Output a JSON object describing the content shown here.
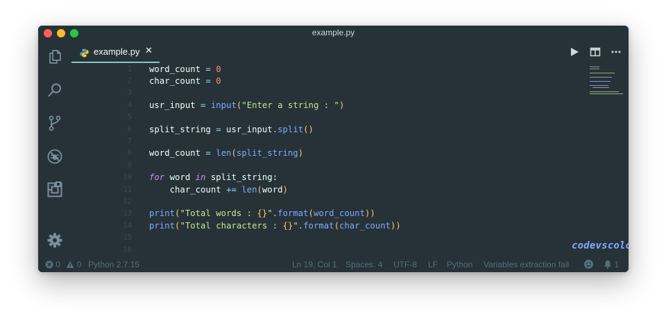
{
  "window": {
    "title": "example.py"
  },
  "tab": {
    "label": "example.py",
    "close": "✕"
  },
  "editor": {
    "lines": [
      {
        "num": "1",
        "tokens": [
          {
            "t": "word_count ",
            "c": "text"
          },
          {
            "t": "=",
            "c": "op"
          },
          {
            "t": " ",
            "c": "text"
          },
          {
            "t": "0",
            "c": "num"
          }
        ]
      },
      {
        "num": "2",
        "tokens": [
          {
            "t": "char_count ",
            "c": "text"
          },
          {
            "t": "=",
            "c": "op"
          },
          {
            "t": " ",
            "c": "text"
          },
          {
            "t": "0",
            "c": "num"
          }
        ]
      },
      {
        "num": "3",
        "tokens": []
      },
      {
        "num": "4",
        "tokens": [
          {
            "t": "usr_input ",
            "c": "text"
          },
          {
            "t": "=",
            "c": "op"
          },
          {
            "t": " ",
            "c": "text"
          },
          {
            "t": "input",
            "c": "func"
          },
          {
            "t": "(",
            "c": "paren"
          },
          {
            "t": "\"Enter a string : \"",
            "c": "str"
          },
          {
            "t": ")",
            "c": "paren"
          }
        ]
      },
      {
        "num": "5",
        "tokens": []
      },
      {
        "num": "6",
        "tokens": [
          {
            "t": "split_string ",
            "c": "text"
          },
          {
            "t": "=",
            "c": "op"
          },
          {
            "t": " usr_input",
            "c": "text"
          },
          {
            "t": ".",
            "c": "op"
          },
          {
            "t": "split",
            "c": "func"
          },
          {
            "t": "()",
            "c": "paren"
          }
        ]
      },
      {
        "num": "7",
        "tokens": []
      },
      {
        "num": "8",
        "tokens": [
          {
            "t": "word_count ",
            "c": "text"
          },
          {
            "t": "=",
            "c": "op"
          },
          {
            "t": " ",
            "c": "text"
          },
          {
            "t": "len",
            "c": "func"
          },
          {
            "t": "(",
            "c": "paren"
          },
          {
            "t": "split_string",
            "c": "func"
          },
          {
            "t": ")",
            "c": "paren"
          }
        ]
      },
      {
        "num": "9",
        "tokens": []
      },
      {
        "num": "10",
        "tokens": [
          {
            "t": "for",
            "c": "kw"
          },
          {
            "t": " word ",
            "c": "text"
          },
          {
            "t": "in",
            "c": "kw"
          },
          {
            "t": " split_string:",
            "c": "text"
          }
        ]
      },
      {
        "num": "11",
        "tokens": [
          {
            "t": "    char_count ",
            "c": "text"
          },
          {
            "t": "+=",
            "c": "op"
          },
          {
            "t": " ",
            "c": "text"
          },
          {
            "t": "len",
            "c": "func"
          },
          {
            "t": "(",
            "c": "paren"
          },
          {
            "t": "word",
            "c": "text"
          },
          {
            "t": ")",
            "c": "paren"
          }
        ]
      },
      {
        "num": "12",
        "tokens": []
      },
      {
        "num": "13",
        "tokens": [
          {
            "t": "print",
            "c": "func"
          },
          {
            "t": "(",
            "c": "paren"
          },
          {
            "t": "\"Total words : ",
            "c": "str"
          },
          {
            "t": "{}",
            "c": "paren"
          },
          {
            "t": "\"",
            "c": "str"
          },
          {
            "t": ".",
            "c": "op"
          },
          {
            "t": "format",
            "c": "func"
          },
          {
            "t": "(",
            "c": "paren"
          },
          {
            "t": "word_count",
            "c": "func"
          },
          {
            "t": "))",
            "c": "paren"
          }
        ]
      },
      {
        "num": "14",
        "tokens": [
          {
            "t": "print",
            "c": "func"
          },
          {
            "t": "(",
            "c": "paren"
          },
          {
            "t": "\"Total characters : ",
            "c": "str"
          },
          {
            "t": "{}",
            "c": "paren"
          },
          {
            "t": "\"",
            "c": "str"
          },
          {
            "t": ".",
            "c": "op"
          },
          {
            "t": "format",
            "c": "func"
          },
          {
            "t": "(",
            "c": "paren"
          },
          {
            "t": "char_count",
            "c": "func"
          },
          {
            "t": "))",
            "c": "paren"
          }
        ]
      },
      {
        "num": "15",
        "tokens": []
      },
      {
        "num": "16",
        "tokens": []
      }
    ]
  },
  "watermark": "codevscolor.com",
  "statusbar": {
    "errors": "0",
    "warnings": "0",
    "interpreter": "Python 2.7.15",
    "position": "Ln 19, Col 1",
    "spaces": "Spaces: 4",
    "encoding": "UTF-8",
    "eol": "LF",
    "language": "Python",
    "message": "Variables extraction fail",
    "notifications": "1"
  },
  "icons": {
    "activity": [
      "files-icon",
      "search-icon",
      "source-control-icon",
      "debug-icon",
      "extensions-icon",
      "settings-gear-icon"
    ],
    "tab_actions": [
      "run-icon",
      "split-editor-icon",
      "more-actions-icon"
    ]
  },
  "colors": {
    "background": "#263238",
    "foreground": "#eeffff",
    "accent": "#80cbc4",
    "keyword": "#c792ea",
    "function": "#82aaff",
    "string": "#c3e88d",
    "number": "#f78c6c",
    "operator": "#89ddff",
    "bracket": "#ffcb6b"
  }
}
